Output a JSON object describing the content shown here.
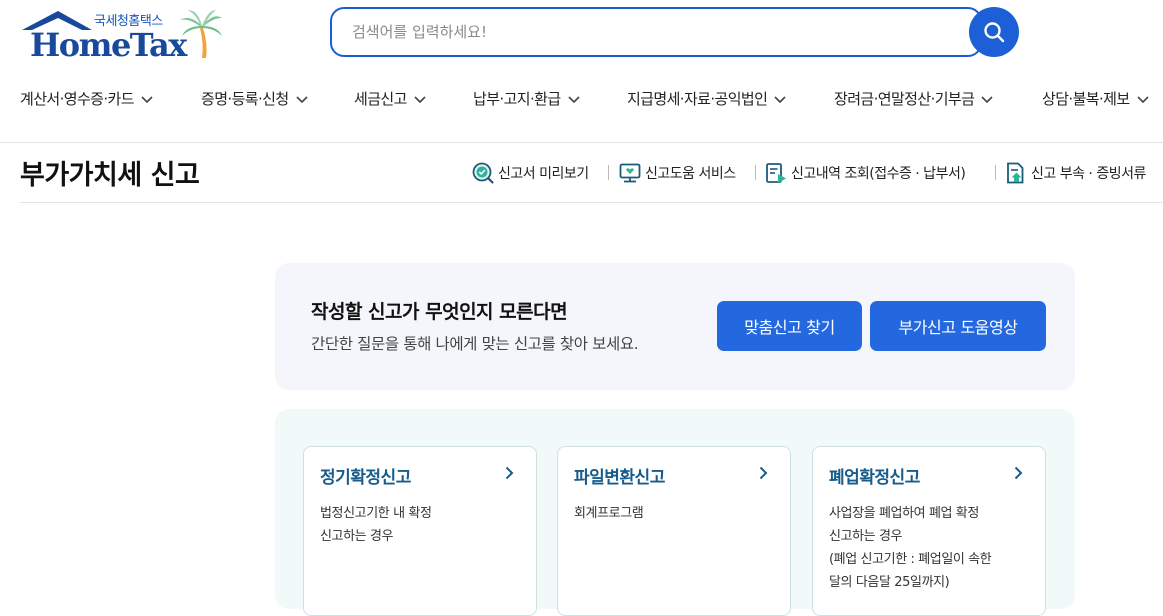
{
  "logo": {
    "sub": "국세청홈택스",
    "main": "HomeTax"
  },
  "search": {
    "placeholder": "검색어를 입력하세요!"
  },
  "nav": [
    {
      "label": "계산서·영수증·카드"
    },
    {
      "label": "증명·등록·신청"
    },
    {
      "label": "세금신고"
    },
    {
      "label": "납부·고지·환급"
    },
    {
      "label": "지급명세·자료·공익법인"
    },
    {
      "label": "장려금·연말정산·기부금"
    },
    {
      "label": "상담·불복·제보"
    }
  ],
  "page": {
    "title": "부가가치세 신고"
  },
  "utilities": [
    {
      "label": "신고서 미리보기",
      "icon": "magnifier-check-icon"
    },
    {
      "label": "신고도움 서비스",
      "icon": "monitor-heart-icon"
    },
    {
      "label": "신고내역 조회(접수증 · 납부서)",
      "icon": "document-play-icon"
    },
    {
      "label": "신고 부속 · 증빙서류",
      "icon": "document-upload-icon"
    }
  ],
  "banner": {
    "title": "작성할 신고가 무엇인지 모른다면",
    "desc": "간단한 질문을 통해 나에게 맞는 신고를 찾아 보세요.",
    "btn_find": "맞춤신고 찾기",
    "btn_video": "부가신고 도움영상"
  },
  "cards": [
    {
      "title": "정기확정신고",
      "desc": [
        "법정신고기한 내 확정",
        "신고하는 경우"
      ]
    },
    {
      "title": "파일변환신고",
      "desc": [
        "회계프로그램"
      ]
    },
    {
      "title": "폐업확정신고",
      "desc": [
        "사업장을 폐업하여 폐업 확정",
        "신고하는 경우",
        "(폐업 신고기한 : 폐업일이 속한",
        "달의 다음달 25일까지)"
      ]
    }
  ],
  "colors": {
    "primary": "#1c5fd6",
    "button": "#2468e0",
    "card_title": "#175c8c"
  }
}
